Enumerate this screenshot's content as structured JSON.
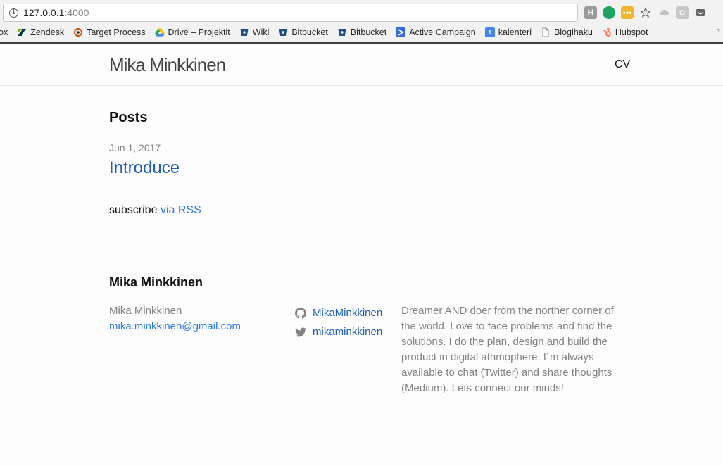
{
  "browser": {
    "url_host": "127.0.0.1",
    "url_port": ":4000",
    "bookmarks": [
      {
        "label": "ox",
        "icon": "partial-icon"
      },
      {
        "label": "Zendesk",
        "icon": "zendesk-icon",
        "color": "#03363d"
      },
      {
        "label": "Target Process",
        "icon": "targetprocess-icon",
        "color": "#d35400"
      },
      {
        "label": "Drive – Projektit",
        "icon": "drive-icon",
        "color": "#1fa463"
      },
      {
        "label": "Wiki",
        "icon": "bitbucket-icon",
        "color": "#205081"
      },
      {
        "label": "Bitbucket",
        "icon": "bitbucket-icon",
        "color": "#205081"
      },
      {
        "label": "Bitbucket",
        "icon": "bitbucket-icon",
        "color": "#205081"
      },
      {
        "label": "Active Campaign",
        "icon": "activecampaign-icon",
        "color": "#356ae6"
      },
      {
        "label": "kalenteri",
        "icon": "calendar-icon",
        "color": "#4285f4"
      },
      {
        "label": "Blogihaku",
        "icon": "page-icon",
        "color": "#888888"
      },
      {
        "label": "Hubspot",
        "icon": "hubspot-icon",
        "color": "#ff7a59"
      }
    ],
    "more_label": "›"
  },
  "header": {
    "site_title": "Mika Minkkinen",
    "nav_cv": "CV"
  },
  "main": {
    "posts_heading": "Posts",
    "post": {
      "date": "Jun 1, 2017",
      "title": "Introduce"
    },
    "subscribe_text": "subscribe",
    "subscribe_link": "via RSS"
  },
  "footer": {
    "heading": "Mika Minkkinen",
    "name": "Mika Minkkinen",
    "email": "mika.minkkinen@gmail.com",
    "github": "MikaMinkkinen",
    "twitter": "mikaminkkinen",
    "description": "Dreamer AND doer from the norther corner of the world. Love to face problems and find the solutions. I do the plan, design and build the product in digital athmophere. I´m always available to chat (Twitter) and share thoughts (Medium). Lets connect our minds!"
  },
  "colors": {
    "link": "#2a7ae2",
    "muted": "#828282"
  }
}
